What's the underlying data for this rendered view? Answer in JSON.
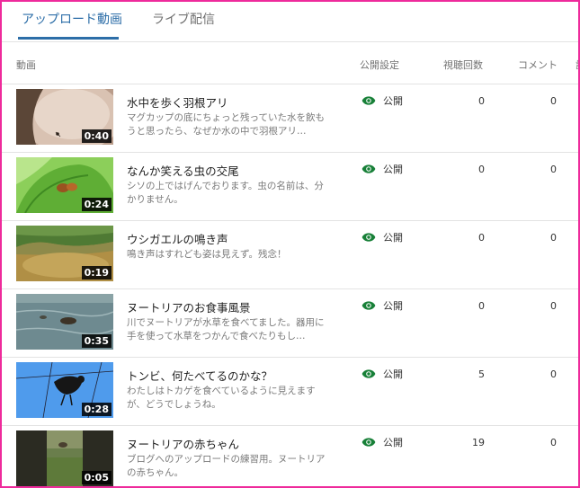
{
  "tabs": {
    "uploads": "アップロード動画",
    "live": "ライブ配信"
  },
  "columns": {
    "video": "動画",
    "visibility": "公開設定",
    "views": "視聴回数",
    "comments": "コメント",
    "extra": "評"
  },
  "videos": [
    {
      "title": "水中を歩く羽根アリ",
      "description": "マグカップの底にちょっと残っていた水を飲もうと思ったら、なぜか水の中で羽根アリ…",
      "duration": "0:40",
      "visibility": "公開",
      "views": "0",
      "comments": "0",
      "thumb_icon": "ant-in-cup"
    },
    {
      "title": "なんか笑える虫の交尾",
      "description": "シソの上ではげんでおります。虫の名前は、分かりません。",
      "duration": "0:24",
      "visibility": "公開",
      "views": "0",
      "comments": "0",
      "thumb_icon": "bugs-on-leaf"
    },
    {
      "title": "ウシガエルの鳴き声",
      "description": "鳴き声はすれども姿は見えず。残念！",
      "duration": "0:19",
      "visibility": "公開",
      "views": "0",
      "comments": "0",
      "thumb_icon": "pond"
    },
    {
      "title": "ヌートリアのお食事風景",
      "description": "川でヌートリアが水草を食べてました。器用に手を使って水草をつかんで食べたりもし…",
      "duration": "0:35",
      "visibility": "公開",
      "views": "0",
      "comments": "0",
      "thumb_icon": "river"
    },
    {
      "title": "トンビ、何たべてるのかな？",
      "description": "わたしはトカゲを食べているように見えますが、どうでしょうね。",
      "duration": "0:28",
      "visibility": "公開",
      "views": "5",
      "comments": "0",
      "thumb_icon": "kite-on-wire"
    },
    {
      "title": "ヌートリアの赤ちゃん",
      "description": "ブログへのアップロードの練習用。ヌートリアの赤ちゃん。",
      "duration": "0:05",
      "visibility": "公開",
      "views": "19",
      "comments": "0",
      "thumb_icon": "grass"
    }
  ],
  "colors": {
    "accent": "#2d6ea8",
    "public_icon": "#188038",
    "frame": "#ee2a9b"
  }
}
